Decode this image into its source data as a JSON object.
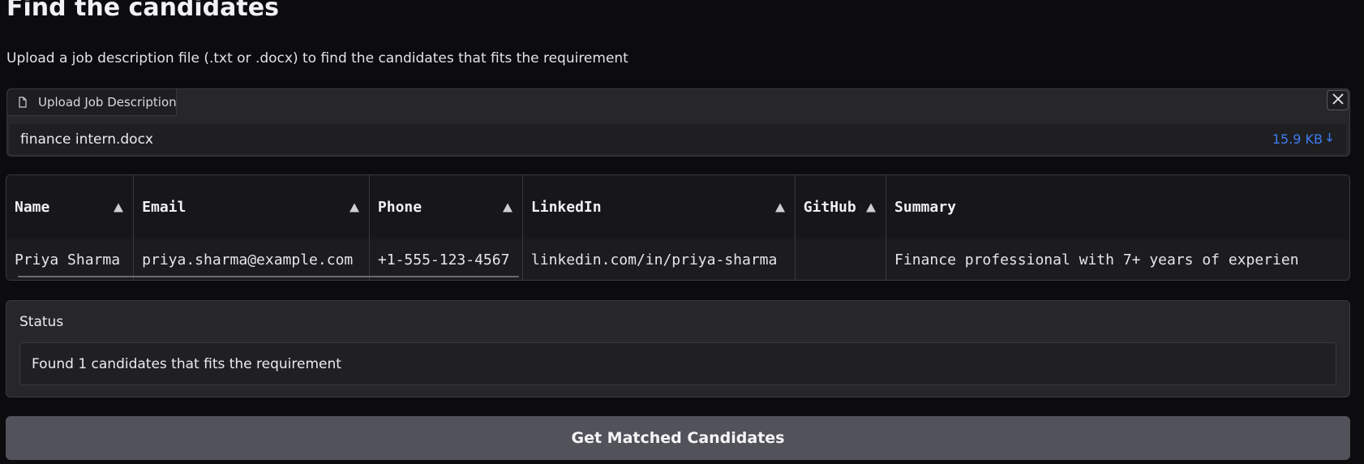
{
  "page": {
    "title": "Find the candidates",
    "subtitle": "Upload a job description file (.txt or .docx) to find the candidates that fits the requirement"
  },
  "upload": {
    "tab_label": "Upload Job Description",
    "tab_icon": "file-icon",
    "close_icon": "close-icon",
    "file_name": "finance intern.docx",
    "file_size": "15.9 KB",
    "download_icon": "download-icon"
  },
  "table": {
    "columns": [
      "Name",
      "Email",
      "Phone",
      "LinkedIn",
      "GitHub",
      "Summary"
    ],
    "rows": [
      {
        "name": "Priya Sharma",
        "email": "priya.sharma@example.com",
        "phone": "+1-555-123-4567",
        "linkedin": "linkedin.com/in/priya-sharma",
        "github": "",
        "summary": "Finance professional with 7+ years of experien"
      }
    ]
  },
  "status": {
    "label": "Status",
    "message": "Found 1 candidates that fits the requirement"
  },
  "actions": {
    "submit_label": "Get Matched Candidates"
  },
  "colors": {
    "background": "#0c0c0f",
    "panel": "#27272a",
    "accent_link": "#3d7cf0",
    "button": "#52525b"
  }
}
